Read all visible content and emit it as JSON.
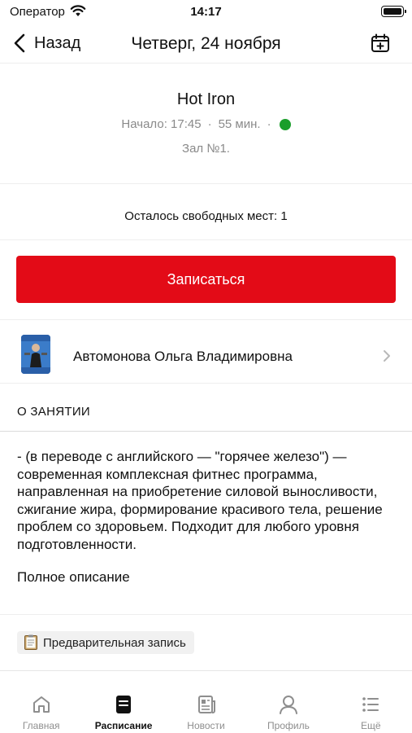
{
  "status_bar": {
    "carrier": "Оператор",
    "time": "14:17"
  },
  "nav": {
    "back_label": "Назад",
    "title": "Четверг, 24 ноября"
  },
  "class": {
    "name": "Hot Iron",
    "start": "Начало: 17:45",
    "separator": "·",
    "duration": "55 мин.",
    "status_color": "#1a9e2b",
    "hall": "Зал №1."
  },
  "seats": {
    "text": "Осталось свободных мест: 1"
  },
  "signup_button": {
    "label": "Записаться",
    "color": "#e30b17"
  },
  "trainer": {
    "name": "Автомонова Ольга Владимировна"
  },
  "about": {
    "section_title": "О ЗАНЯТИИ",
    "description": "- (в переводе с английского — \"горячее железо\") — современная комплексная фитнес программа, направленная на приобретение силовой выносливости, сжигание жира, формирование красивого тела, решение проблем со здоровьем. Подходит для любого уровня подготовленности.",
    "full_description_link": "Полное описание"
  },
  "tag": {
    "icon": "clipboard-icon",
    "label": "Предварительная запись"
  },
  "tab_bar": {
    "items": [
      {
        "label": "Главная",
        "icon": "home-icon"
      },
      {
        "label": "Расписание",
        "icon": "schedule-icon"
      },
      {
        "label": "Новости",
        "icon": "news-icon"
      },
      {
        "label": "Профиль",
        "icon": "profile-icon"
      },
      {
        "label": "Ещё",
        "icon": "more-icon"
      }
    ],
    "active_index": 1
  }
}
